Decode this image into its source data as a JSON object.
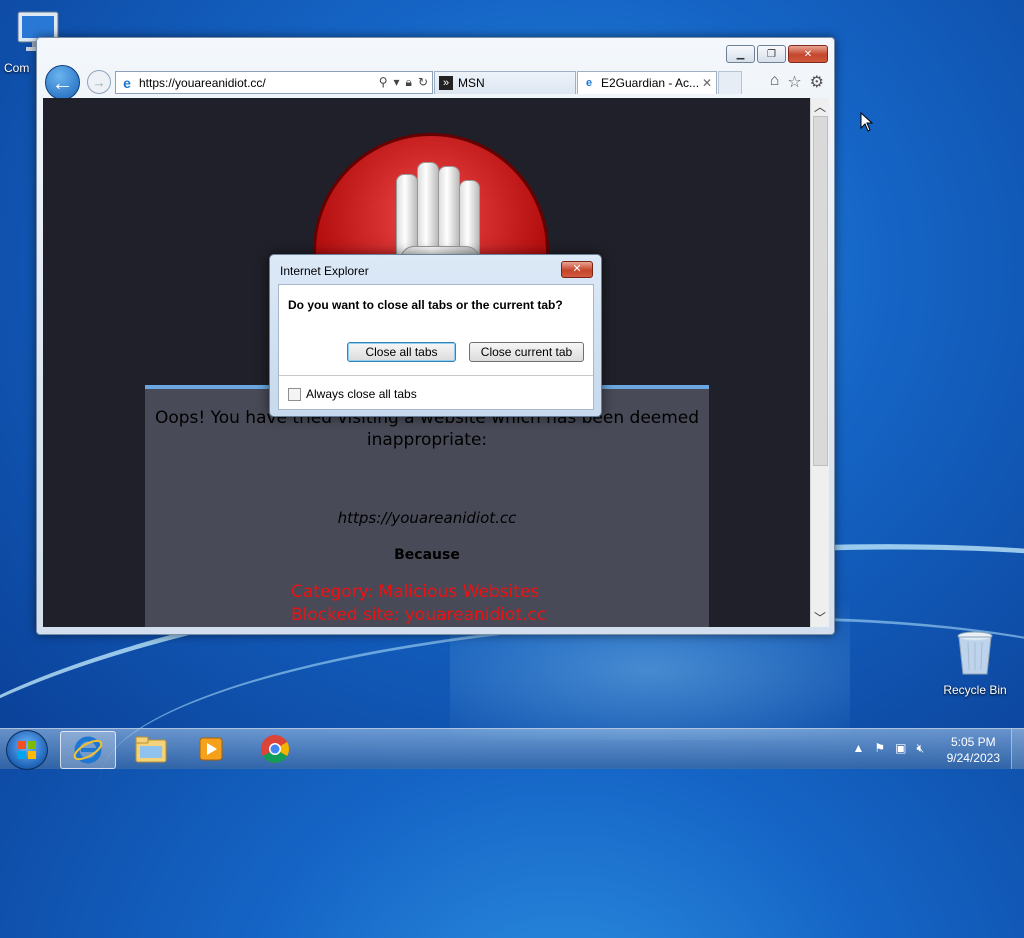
{
  "desktop": {
    "computer_label": "Com",
    "recycle_label": "Recycle Bin"
  },
  "ie": {
    "address_url": "https://youareanidiot.cc/",
    "tabs": [
      {
        "label": "MSN"
      },
      {
        "label": "E2Guardian - Ac..."
      }
    ]
  },
  "page": {
    "oops_line1": "Oops! You have tried visiting a website which has been deemed",
    "oops_line2": "inappropriate:",
    "blocked_url": "https://youareanidiot.cc",
    "because": "Because",
    "category": "Category: Malicious Websites",
    "blocked_site": "Blocked site: youareanidiot.cc"
  },
  "dialog": {
    "title": "Internet Explorer",
    "question": "Do you want to close all tabs or the current tab?",
    "close_all": "Close all tabs",
    "close_current": "Close current tab",
    "always_close": "Always close all tabs",
    "always_checked": false
  },
  "taskbar": {
    "time": "5:05 PM",
    "date": "9/24/2023"
  }
}
